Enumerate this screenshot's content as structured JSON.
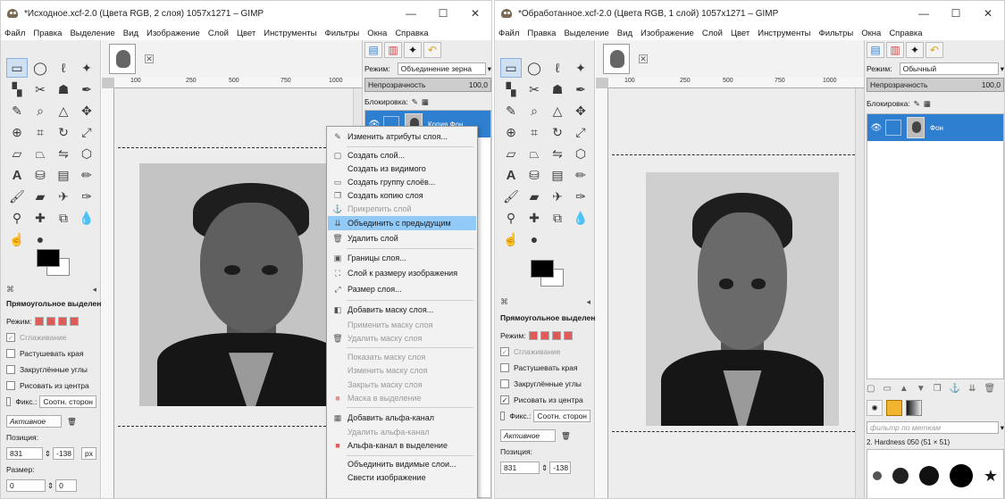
{
  "left_window": {
    "title": "*Исходное.xcf-2.0 (Цвета RGB, 2 слоя) 1057x1271 – GIMP",
    "controls": {
      "minimize": "—",
      "maximize": "☐",
      "close": "✕"
    },
    "menu": [
      "Файл",
      "Правка",
      "Выделение",
      "Вид",
      "Изображение",
      "Слой",
      "Цвет",
      "Инструменты",
      "Фильтры",
      "Окна",
      "Справка"
    ],
    "tab_close": "✕",
    "ruler_marks": [
      "100",
      "250",
      "500",
      "750",
      "1000"
    ],
    "tool_options": {
      "title": "Прямоугольное выделение",
      "mode_label": "Режим:",
      "antialias": "Сглаживание",
      "feather": "Растушевать края",
      "rounded": "Закруглённые углы",
      "from_center": "Рисовать из центра",
      "fixed": "Фикс.:",
      "fixed_value": "Соотн. сторон",
      "active_value": "Активное",
      "position_label": "Позиция:",
      "position_x": "831",
      "position_y": "-138",
      "unit": "px",
      "size_label": "Размер:",
      "size_x": "0",
      "size_y": "0"
    },
    "layers": {
      "mode_label": "Режим:",
      "mode_value": "Объединение зерна",
      "opacity_label": "Непрозрачность",
      "opacity_value": "100,0",
      "lock_label": "Блокировка:",
      "layer_name": "Копия Фон"
    },
    "context_menu": [
      {
        "label": "Изменить атрибуты слоя...",
        "icon": "✎",
        "state": "normal"
      },
      {
        "label": "Создать слой...",
        "icon": "▢",
        "state": "normal"
      },
      {
        "label": "Создать из видимого",
        "icon": "",
        "state": "normal"
      },
      {
        "label": "Создать группу слоёв...",
        "icon": "▭",
        "state": "normal"
      },
      {
        "label": "Создать копию слоя",
        "icon": "❐",
        "state": "normal"
      },
      {
        "label": "Прикрепить слой",
        "icon": "⚓",
        "state": "disabled"
      },
      {
        "label": "Объединить с предыдущим",
        "icon": "⇊",
        "state": "highlighted"
      },
      {
        "label": "Удалить слой",
        "icon": "🗑",
        "state": "normal"
      },
      {
        "label": "Границы слоя...",
        "icon": "▣",
        "state": "normal"
      },
      {
        "label": "Слой к размеру изображения",
        "icon": "⛶",
        "state": "normal"
      },
      {
        "label": "Размер слоя...",
        "icon": "⤢",
        "state": "normal"
      },
      {
        "label": "Добавить маску слоя...",
        "icon": "◧",
        "state": "normal"
      },
      {
        "label": "Применить маску слоя",
        "icon": "",
        "state": "disabled"
      },
      {
        "label": "Удалить маску слоя",
        "icon": "🗑",
        "state": "disabled"
      },
      {
        "label": "Показать маску слоя",
        "icon": "",
        "state": "disabled"
      },
      {
        "label": "Изменить маску слоя",
        "icon": "",
        "state": "disabled"
      },
      {
        "label": "Закрыть маску слоя",
        "icon": "",
        "state": "disabled"
      },
      {
        "label": "Маска в выделение",
        "icon": "■",
        "state": "disabled"
      },
      {
        "label": "Добавить альфа-канал",
        "icon": "▦",
        "state": "normal"
      },
      {
        "label": "Удалить альфа-канал",
        "icon": "",
        "state": "disabled"
      },
      {
        "label": "Альфа-канал в выделение",
        "icon": "■",
        "state": "normal"
      },
      {
        "label": "Объединить видимые слои...",
        "icon": "",
        "state": "normal"
      },
      {
        "label": "Свести изображение",
        "icon": "",
        "state": "normal"
      }
    ]
  },
  "right_window": {
    "title": "*Обработанное.xcf-2.0 (Цвета RGB, 1 слой) 1057x1271 – GIMP",
    "controls": {
      "minimize": "—",
      "maximize": "☐",
      "close": "✕"
    },
    "menu": [
      "Файл",
      "Правка",
      "Выделение",
      "Вид",
      "Изображение",
      "Слой",
      "Цвет",
      "Инструменты",
      "Фильтры",
      "Окна",
      "Справка"
    ],
    "tab_close": "✕",
    "ruler_marks": [
      "100",
      "250",
      "500",
      "750",
      "1000"
    ],
    "tool_options": {
      "title": "Прямоугольное выделение",
      "mode_label": "Режим:",
      "antialias": "Сглаживание",
      "feather": "Растушевать края",
      "rounded": "Закруглённые углы",
      "from_center": "Рисовать из центра",
      "fixed": "Фикс.:",
      "fixed_value": "Соотн. сторон",
      "active_value": "Активное",
      "position_label": "Позиция:",
      "position_x": "831",
      "position_y": "-138"
    },
    "layers": {
      "mode_label": "Режим:",
      "mode_value": "Обычный",
      "opacity_label": "Непрозрачность",
      "opacity_value": "100,0",
      "lock_label": "Блокировка:",
      "layer_name": "Фон"
    },
    "brushes": {
      "filter_placeholder": "фильтр по меткам",
      "brush_name": "2. Hardness 050 (51 × 51)"
    }
  }
}
